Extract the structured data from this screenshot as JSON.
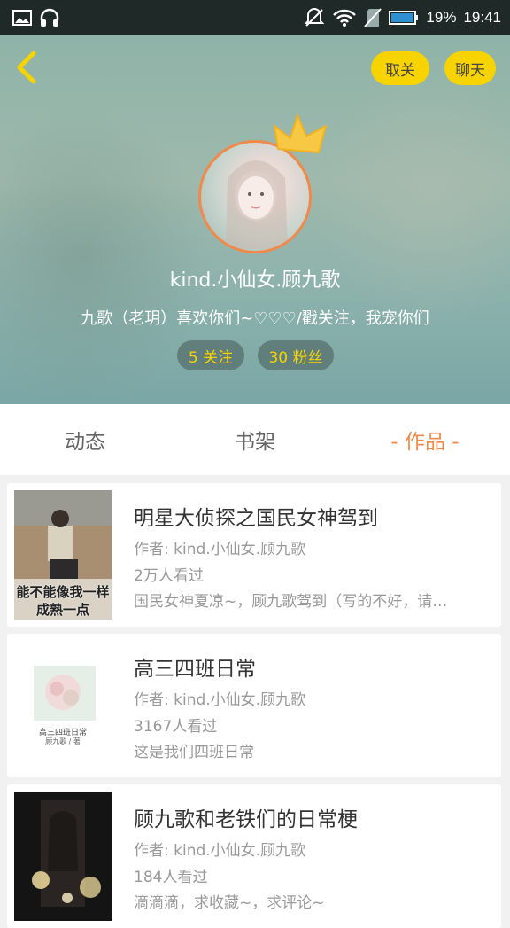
{
  "status_bar": {
    "left_icons": [
      "image-icon",
      "headset-icon"
    ],
    "right_icons": [
      "mute-icon",
      "wifi-icon",
      "no-sim-icon",
      "battery-icon"
    ],
    "battery_percent": "19%",
    "time": "19:41"
  },
  "header": {
    "unfollow_label": "取关",
    "chat_label": "聊天",
    "username": "kind.小仙女.顾九歌",
    "bio": "九歌（老玥）喜欢你们~♡♡♡/戳关注，我宠你们",
    "following": "5 关注",
    "fans": "30 粉丝",
    "accent_color": "#f7d300",
    "avatar_border_color": "#f08a4b"
  },
  "tabs": [
    {
      "label": "动态",
      "active": false
    },
    {
      "label": "书架",
      "active": false
    },
    {
      "label": "- 作品 -",
      "active": true
    }
  ],
  "works": [
    {
      "title": "明星大侦探之国民女神驾到",
      "author": "作者: kind.小仙女.顾九歌",
      "views": "2万人看过",
      "desc": "国民女神夏凉~，顾九歌驾到（写的不好，请…",
      "cover_text": [
        "能不能像我一样",
        "成熟一点"
      ]
    },
    {
      "title": "高三四班日常",
      "author": "作者: kind.小仙女.顾九歌",
      "views": "3167人看过",
      "desc": "这是我们四班日常",
      "cover_text": [
        "高三四班日常",
        "顾九歌 / 著"
      ]
    },
    {
      "title": "顾九歌和老铁们的日常梗",
      "author": "作者: kind.小仙女.顾九歌",
      "views": "184人看过",
      "desc": "滴滴滴，求收藏~，求评论~",
      "cover_text": []
    }
  ]
}
